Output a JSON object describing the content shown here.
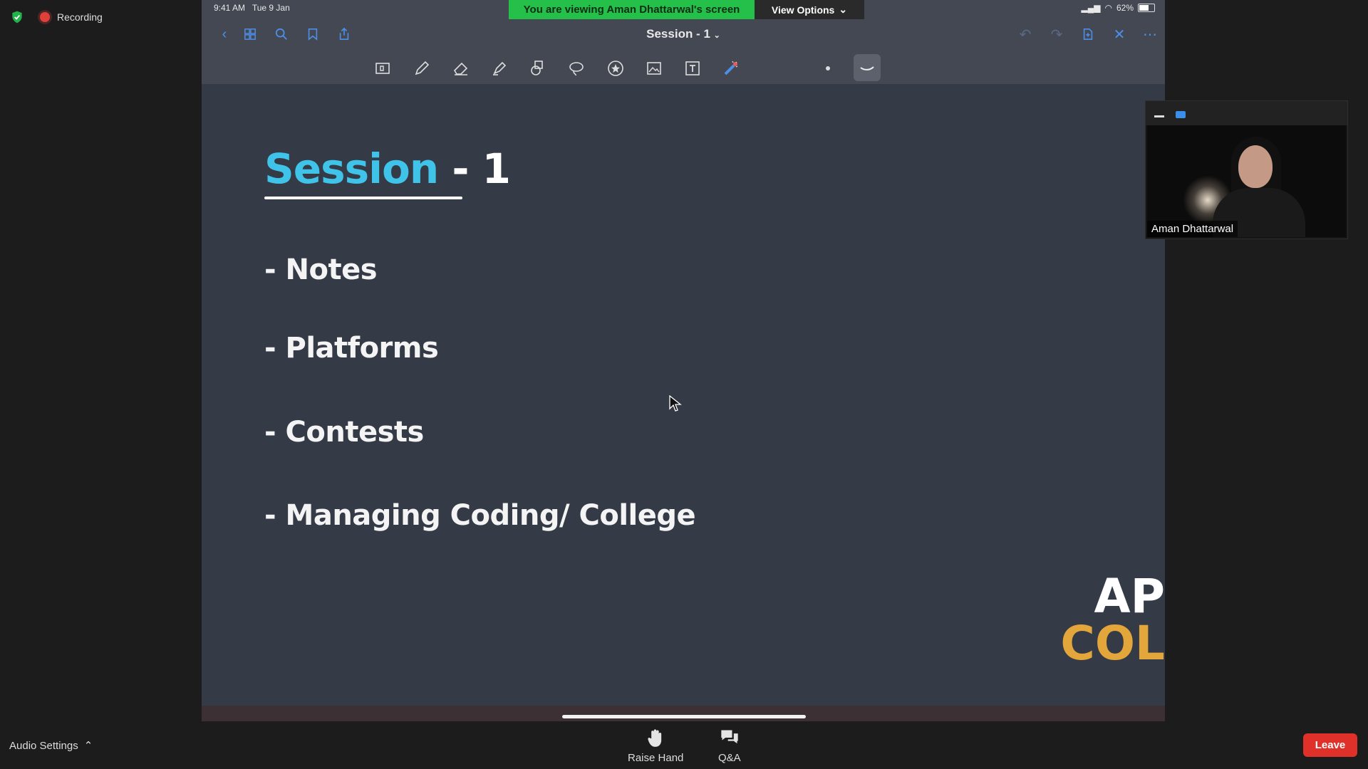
{
  "zoom": {
    "recording_label": "Recording",
    "banner_text": "You are viewing Aman Dhattarwal's screen",
    "view_options_label": "View Options",
    "participant_name": "Aman Dhattarwal",
    "audio_settings_label": "Audio Settings",
    "raise_hand_label": "Raise Hand",
    "qa_label": "Q&A",
    "leave_label": "Leave",
    "leave_color": "#e0302a",
    "banner_color": "#25c04a"
  },
  "ipad": {
    "time": "9:41 AM",
    "date": "Tue 9 Jan",
    "battery": "62%",
    "document_title": "Session - 1"
  },
  "slide": {
    "title_word": "Session",
    "title_suffix": "- 1",
    "bullets": [
      "- Notes",
      "- Platforms",
      "- Contests",
      "- Managing Coding/ College"
    ],
    "logo_line1": "AP",
    "logo_line2": "COL",
    "title_color": "#3fc3e8",
    "logo_accent_color": "#e3a63a"
  }
}
